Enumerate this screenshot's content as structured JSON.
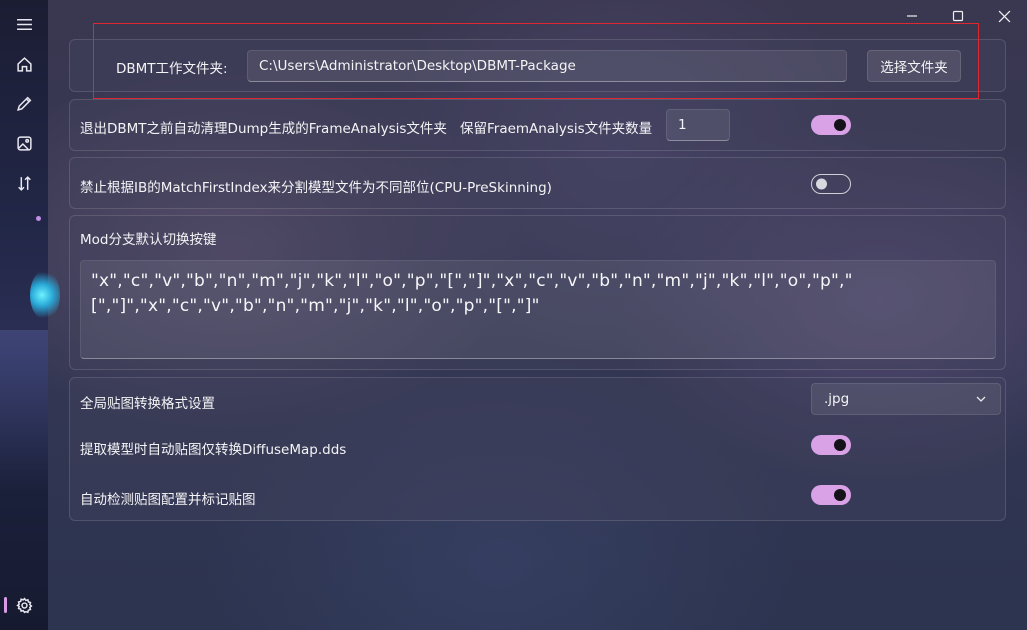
{
  "nav": {
    "items": [
      {
        "icon": "hamburger-menu-icon"
      },
      {
        "icon": "home-icon"
      },
      {
        "icon": "pencil-icon"
      },
      {
        "icon": "image-icon"
      },
      {
        "icon": "sort-arrows-icon"
      },
      {
        "icon": "gear-icon"
      }
    ]
  },
  "window": {
    "controls": [
      "minimize-icon",
      "maximize-icon",
      "close-icon"
    ]
  },
  "workdir": {
    "label": "DBMT工作文件夹:",
    "path": "C:\\Users\\Administrator\\Desktop\\DBMT-Package",
    "choose_button": "选择文件夹"
  },
  "auto_clean": {
    "label": "退出DBMT之前自动清理Dump生成的FrameAnalysis文件夹",
    "keep_label": "保留FraemAnalysis文件夹数量",
    "keep_value": "1",
    "toggle": true
  },
  "disable_split": {
    "label": "禁止根据IB的MatchFirstIndex来分割模型文件为不同部位(CPU-PreSkinning)",
    "toggle": false
  },
  "mod_keys": {
    "label": "Mod分支默认切换按键",
    "value": "\"x\",\"c\",\"v\",\"b\",\"n\",\"m\",\"j\",\"k\",\"l\",\"o\",\"p\",\"[\",\"]\",\"x\",\"c\",\"v\",\"b\",\"n\",\"m\",\"j\",\"k\",\"l\",\"o\",\"p\",\"[\",\"]\",\"x\",\"c\",\"v\",\"b\",\"n\",\"m\",\"j\",\"k\",\"l\",\"o\",\"p\",\"[\",\"]\""
  },
  "texture": {
    "format_label": "全局贴图转换格式设置",
    "format_value": ".jpg",
    "diffuse_label": "提取模型时自动贴图仅转换DiffuseMap.dds",
    "diffuse_toggle": true,
    "detect_label": "自动检测贴图配置并标记贴图",
    "detect_toggle": true
  },
  "colors": {
    "accent": "#d9a1e6",
    "highlight_border": "#e0262e"
  }
}
